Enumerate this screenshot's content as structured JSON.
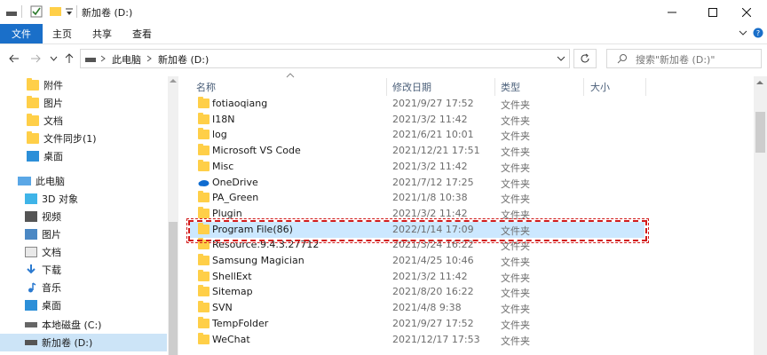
{
  "window": {
    "title": "新加卷 (D:)"
  },
  "ribbon": {
    "tabs": [
      {
        "label": "文件"
      },
      {
        "label": "主页"
      },
      {
        "label": "共享"
      },
      {
        "label": "查看"
      }
    ]
  },
  "nav": {
    "breadcrumbs": [
      "此电脑",
      "新加卷 (D:)"
    ],
    "search_placeholder": "搜索\"新加卷 (D:)\""
  },
  "sidebar": {
    "items": [
      {
        "label": "附件",
        "icon": "folder-icon"
      },
      {
        "label": "图片",
        "icon": "folder-icon"
      },
      {
        "label": "文档",
        "icon": "folder-icon"
      },
      {
        "label": "文件同步(1)",
        "icon": "folder-icon"
      },
      {
        "label": "桌面",
        "icon": "folder-icon"
      },
      {
        "label": "此电脑",
        "icon": "computer-icon"
      },
      {
        "label": "3D 对象",
        "icon": "3d-objects-icon"
      },
      {
        "label": "视频",
        "icon": "video-icon"
      },
      {
        "label": "图片",
        "icon": "pictures-icon"
      },
      {
        "label": "文档",
        "icon": "documents-icon"
      },
      {
        "label": "下载",
        "icon": "download-icon"
      },
      {
        "label": "音乐",
        "icon": "music-icon"
      },
      {
        "label": "桌面",
        "icon": "desktop-icon"
      },
      {
        "label": "本地磁盘 (C:)",
        "icon": "drive-icon"
      },
      {
        "label": "新加卷 (D:)",
        "icon": "drive-icon"
      }
    ]
  },
  "columns": {
    "name": "名称",
    "date": "修改日期",
    "type": "类型",
    "size": "大小"
  },
  "files": [
    {
      "name": "fotiaoqiang",
      "date": "2021/9/27 17:52",
      "type": "文件夹",
      "icon": "folder-icon"
    },
    {
      "name": "I18N",
      "date": "2021/3/2 11:42",
      "type": "文件夹",
      "icon": "folder-icon"
    },
    {
      "name": "log",
      "date": "2021/6/21 10:01",
      "type": "文件夹",
      "icon": "folder-icon"
    },
    {
      "name": "Microsoft VS Code",
      "date": "2021/12/21 17:51",
      "type": "文件夹",
      "icon": "folder-icon"
    },
    {
      "name": "Misc",
      "date": "2021/3/2 11:42",
      "type": "文件夹",
      "icon": "folder-icon"
    },
    {
      "name": "OneDrive",
      "date": "2021/7/12 17:25",
      "type": "文件夹",
      "icon": "onedrive-icon"
    },
    {
      "name": "PA_Green",
      "date": "2021/1/8 10:38",
      "type": "文件夹",
      "icon": "folder-icon"
    },
    {
      "name": "Plugin",
      "date": "2021/3/2 11:42",
      "type": "文件夹",
      "icon": "folder-icon"
    },
    {
      "name": "Program File(86)",
      "date": "2022/1/14 17:09",
      "type": "文件夹",
      "icon": "folder-icon"
    },
    {
      "name": "Resource.9.4.3.27712",
      "date": "2021/3/24 16:22",
      "type": "文件夹",
      "icon": "folder-icon"
    },
    {
      "name": "Samsung Magician",
      "date": "2021/4/25 10:46",
      "type": "文件夹",
      "icon": "folder-icon"
    },
    {
      "name": "ShellExt",
      "date": "2021/3/2 11:42",
      "type": "文件夹",
      "icon": "folder-icon"
    },
    {
      "name": "Sitemap",
      "date": "2021/8/20 16:22",
      "type": "文件夹",
      "icon": "folder-icon"
    },
    {
      "name": "SVN",
      "date": "2021/4/8 9:38",
      "type": "文件夹",
      "icon": "folder-icon"
    },
    {
      "name": "TempFolder",
      "date": "2021/9/27 17:52",
      "type": "文件夹",
      "icon": "folder-icon"
    },
    {
      "name": "WeChat",
      "date": "2021/12/17 17:53",
      "type": "文件夹",
      "icon": "folder-icon"
    }
  ],
  "colors": {
    "accent": "#1a6fc9",
    "selection": "#cce8ff",
    "annotation": "#d21b1b",
    "folder": "#ffcf48"
  }
}
